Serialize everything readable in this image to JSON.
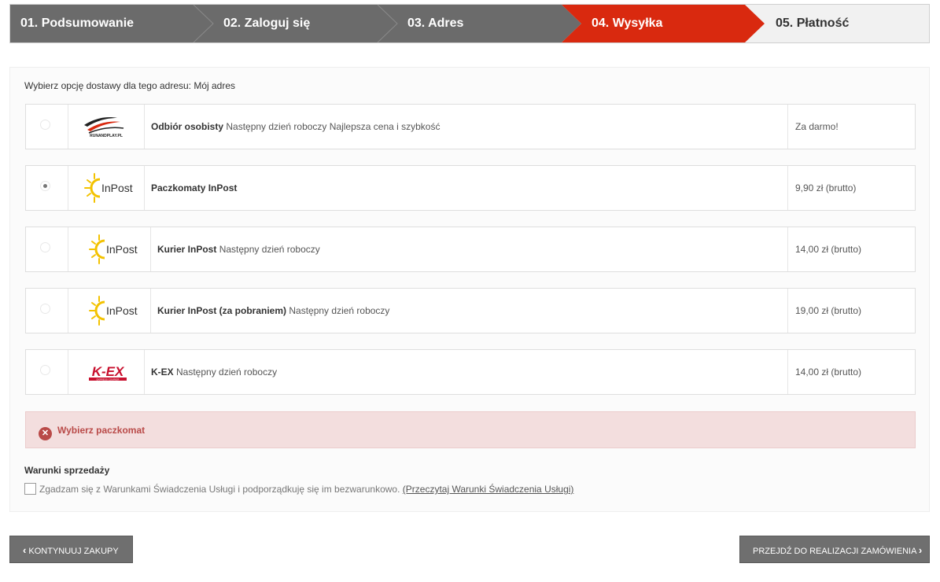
{
  "steps": [
    {
      "label": "01. Podsumowanie",
      "state": "done"
    },
    {
      "label": "02. Zaloguj się",
      "state": "done"
    },
    {
      "label": "03. Adres",
      "state": "done"
    },
    {
      "label": "04. Wysyłka",
      "state": "active"
    },
    {
      "label": "05. Płatność",
      "state": "pending"
    }
  ],
  "colors": {
    "step_done": "#6b6b6b",
    "step_active": "#d9290f",
    "step_pending": "#f1f1f1",
    "error_bg": "#f3dede",
    "error_text": "#b94a48"
  },
  "delivery": {
    "intro": "Wybierz opcję dostawy dla tego adresu: Mój adres",
    "options": [
      {
        "name": "Odbiór osobisty",
        "detail": " Następny dzień roboczy Najlepsza cena i szybkość",
        "price": "Za darmo!",
        "logo": "runandplay-logo",
        "selected": false
      },
      {
        "name": "Paczkomaty InPost",
        "detail": "",
        "price": "9,90 zł (brutto)",
        "logo": "inpost-logo",
        "selected": true
      },
      {
        "name": "Kurier InPost",
        "detail": " Następny dzień roboczy",
        "price": "14,00 zł (brutto)",
        "logo": "inpost-logo",
        "selected": false
      },
      {
        "name": "Kurier InPost (za pobraniem)",
        "detail": " Następny dzień roboczy",
        "price": "19,00 zł (brutto)",
        "logo": "inpost-logo",
        "selected": false
      },
      {
        "name": "K-EX",
        "detail": " Następny dzień roboczy",
        "price": "14,00 zł (brutto)",
        "logo": "kex-logo",
        "selected": false
      }
    ],
    "logo_text": {
      "runandplay": "RUNANDPLAY.PL",
      "inpost": "InPost",
      "kex": "K-EX",
      "kex_sub": "EXPRESS COURIER"
    }
  },
  "alert": {
    "message": "Wybierz paczkomat",
    "icon": "close-circle-icon"
  },
  "terms": {
    "title": "Warunki sprzedaży",
    "text": "Zgadzam się z Warunkami Świadczenia Usługi i podporządkuję się im bezwarunkowo.",
    "link": "(Przeczytaj Warunki Świadczenia Usługi)",
    "checked": false
  },
  "buttons": {
    "back": "KONTYNUUJ ZAKUPY",
    "next": "PRZEJDŹ DO REALIZACJI ZAMÓWIENIA",
    "back_icon": "chevron-left-icon",
    "next_icon": "chevron-right-icon"
  }
}
